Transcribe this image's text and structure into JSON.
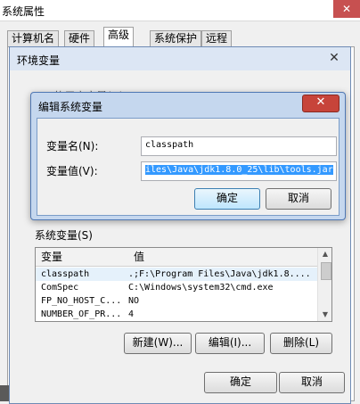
{
  "sysprops": {
    "title": "系统属性",
    "close": "✕",
    "tabs": [
      "计算机名",
      "硬件",
      "高级",
      "系统保护",
      "远程"
    ],
    "active_tab": 2
  },
  "envvars": {
    "title": "环境变量",
    "close": "✕",
    "user_section_label": "xxx的用户变量(U)",
    "system_section_label": "系统变量(S)",
    "table": {
      "headers": [
        "变量",
        "值"
      ],
      "rows": [
        {
          "name": "classpath",
          "value": ".;F:\\Program Files\\Java\\jdk1.8...."
        },
        {
          "name": "ComSpec",
          "value": "C:\\Windows\\system32\\cmd.exe"
        },
        {
          "name": "FP_NO_HOST_C...",
          "value": "NO"
        },
        {
          "name": "NUMBER_OF_PR...",
          "value": "4"
        }
      ]
    },
    "buttons": {
      "new": "新建(W)...",
      "edit": "编辑(I)...",
      "delete": "删除(L)",
      "ok": "确定",
      "cancel": "取消"
    }
  },
  "edit_dialog": {
    "title": "编辑系统变量",
    "close": "✕",
    "name_label": "变量名(N):",
    "name_value": "classpath",
    "value_label": "变量值(V):",
    "value_value": "iles\\Java\\jdk1.8.0_25\\lib\\tools.jar",
    "ok": "确定",
    "cancel": "取消"
  }
}
